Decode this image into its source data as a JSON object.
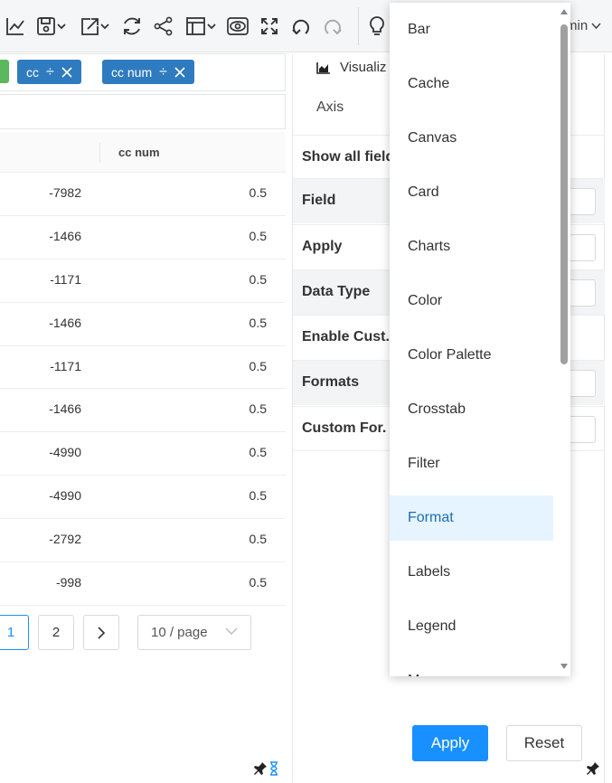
{
  "toolbar": {
    "icons": [
      "line-chart-icon",
      "save-icon",
      "export-icon",
      "refresh-icon",
      "share-icon",
      "layout-icon",
      "preview-icon",
      "fullscreen-icon",
      "undo-icon",
      "redo-icon",
      "lightbulb-icon"
    ],
    "user_label": "min"
  },
  "chips": [
    {
      "label": "cc",
      "symbol": "÷"
    },
    {
      "label": "cc num",
      "symbol": "÷"
    }
  ],
  "grid": {
    "columns": [
      "",
      "cc num"
    ],
    "rows": [
      [
        "-7982",
        "0.5"
      ],
      [
        "-1466",
        "0.5"
      ],
      [
        "-1171",
        "0.5"
      ],
      [
        "-1466",
        "0.5"
      ],
      [
        "-1171",
        "0.5"
      ],
      [
        "-1466",
        "0.5"
      ],
      [
        "-4990",
        "0.5"
      ],
      [
        "-4990",
        "0.5"
      ],
      [
        "-2792",
        "0.5"
      ],
      [
        "-998",
        "0.5"
      ]
    ]
  },
  "pagination": {
    "pages": [
      "1",
      "2"
    ],
    "current": "1",
    "next": ">",
    "page_size": "10 / page"
  },
  "panel": {
    "tab_label": "Visualiz",
    "axis_label": "Axis",
    "rows": [
      {
        "label": "Show all field"
      },
      {
        "label": "Field"
      },
      {
        "label": "Apply"
      },
      {
        "label": "Data Type"
      },
      {
        "label": "Enable Cust."
      },
      {
        "label": "Formats"
      },
      {
        "label": "Custom For."
      }
    ],
    "apply_button": "Apply",
    "reset_button": "Reset"
  },
  "dropdown": {
    "items": [
      "Bar",
      "Cache",
      "Canvas",
      "Card",
      "Charts",
      "Color",
      "Color Palette",
      "Crosstab",
      "Filter",
      "Format",
      "Labels",
      "Legend",
      "M"
    ],
    "selected": "Format"
  },
  "colors": {
    "accent": "#1890ff",
    "chip": "#2f7bbf",
    "chip_green": "#5cb85c",
    "selected_bg": "#e6f4ff"
  }
}
